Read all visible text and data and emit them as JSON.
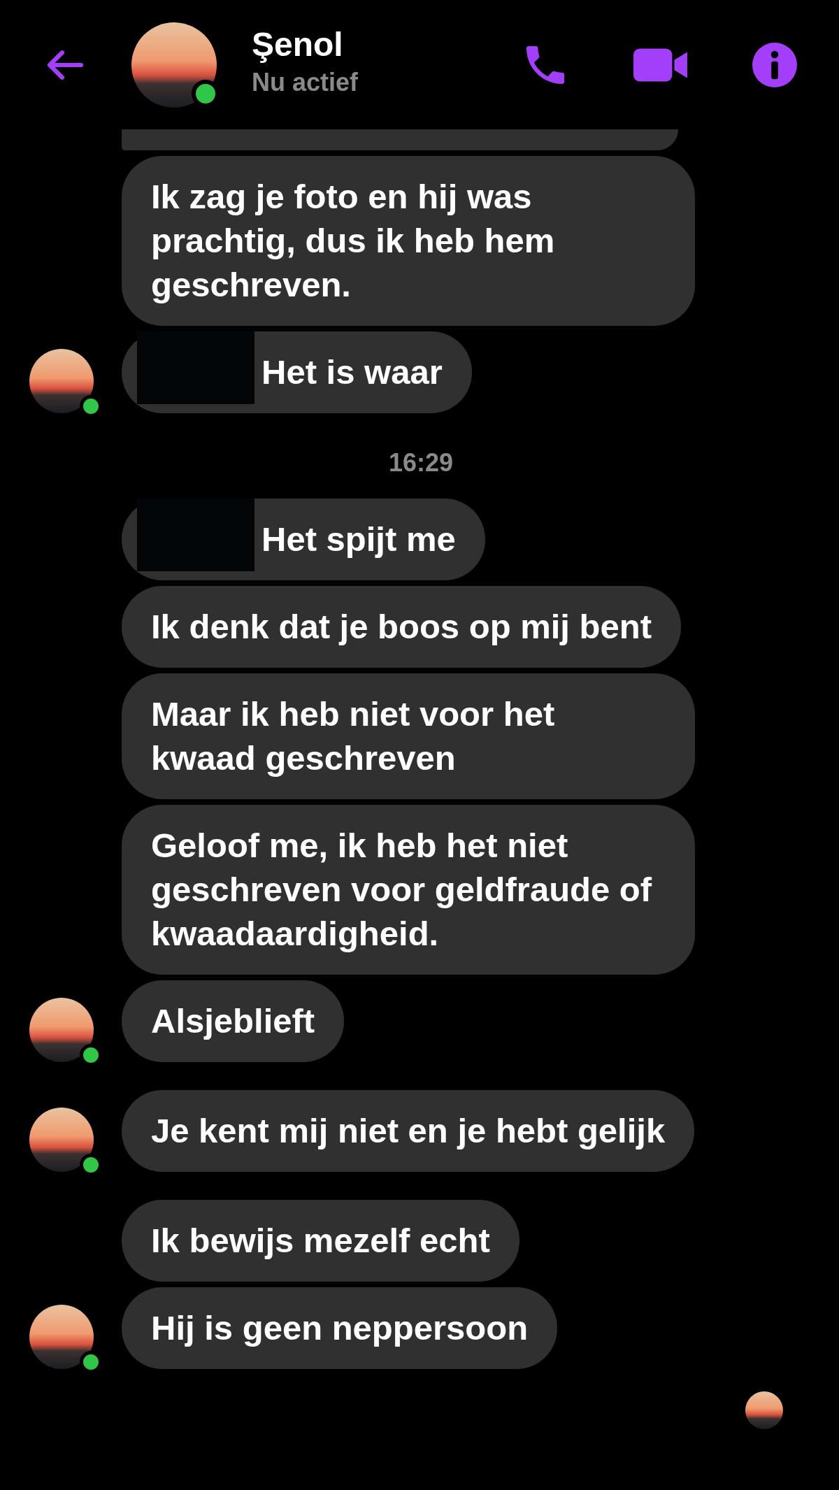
{
  "header": {
    "name": "Şenol",
    "status": "Nu actief",
    "online": true
  },
  "chat": [
    {
      "kind": "group",
      "avatar": true,
      "online": true,
      "messages": [
        {
          "kind": "partial"
        },
        {
          "kind": "text",
          "text": "Ik zag je foto en hij was prachtig, dus ik heb hem geschreven.",
          "redacted": false
        },
        {
          "kind": "text",
          "text": "Het is waar",
          "redacted": true
        }
      ]
    },
    {
      "kind": "timestamp",
      "text": "16:29"
    },
    {
      "kind": "group",
      "avatar": true,
      "online": true,
      "messages": [
        {
          "kind": "text",
          "text": "Het spijt me",
          "redacted": true
        },
        {
          "kind": "text",
          "text": "Ik denk dat je boos op mij bent",
          "redacted": false
        },
        {
          "kind": "text",
          "text": "Maar ik heb niet voor het kwaad geschreven",
          "redacted": false
        },
        {
          "kind": "text",
          "text": "Geloof me, ik heb het niet geschreven voor geldfraude of kwaadaardigheid.",
          "redacted": false
        },
        {
          "kind": "text",
          "text": "Alsjeblieft",
          "redacted": false
        }
      ]
    },
    {
      "kind": "group",
      "avatar": true,
      "online": true,
      "messages": [
        {
          "kind": "text",
          "text": "Je kent mij niet en je hebt gelijk",
          "redacted": false
        }
      ]
    },
    {
      "kind": "group",
      "avatar": true,
      "online": true,
      "messages": [
        {
          "kind": "text",
          "text": "Ik bewijs mezelf echt",
          "redacted": false
        },
        {
          "kind": "text",
          "text": "Hij is geen neppersoon",
          "redacted": false
        }
      ]
    }
  ],
  "seen": true
}
